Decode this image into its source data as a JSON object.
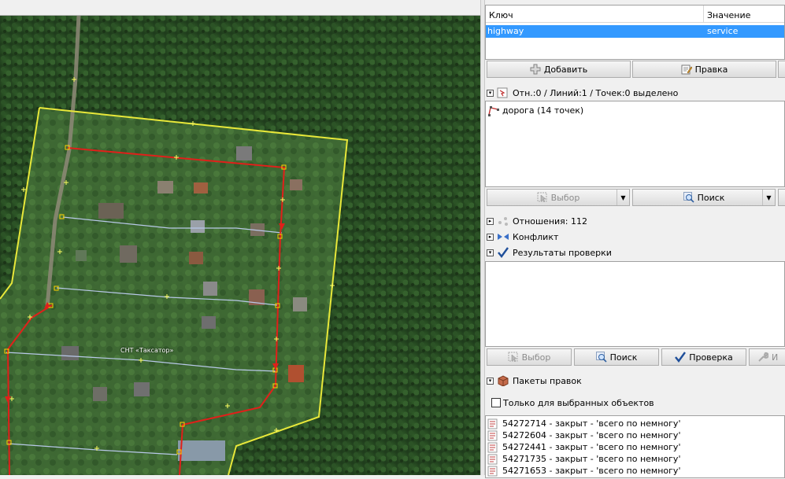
{
  "map": {
    "place_label": "СНТ «Таксатор»"
  },
  "tags": {
    "col_key": "Ключ",
    "col_value": "Значение",
    "rows": [
      {
        "key": "highway",
        "value": "service"
      }
    ],
    "add_label": "Добавить",
    "edit_label": "Правка"
  },
  "selection": {
    "header": "Отн.:0 / Линий:1 / Точек:0 выделено",
    "items": [
      {
        "label": "дорога (14 точек)"
      }
    ],
    "select_label": "Выбор",
    "search_label": "Поиск"
  },
  "relations": {
    "header": "Отношения: 112"
  },
  "conflict": {
    "header": "Конфликт"
  },
  "validation": {
    "header": "Результаты проверки",
    "select_label": "Выбор",
    "search_label": "Поиск",
    "check_label": "Проверка",
    "fix_label": "И"
  },
  "changesets": {
    "header": "Пакеты правок",
    "only_selected_label": "Только для выбранных объектов",
    "items": [
      {
        "label": "54272714 - закрыт - 'всего по немногу'"
      },
      {
        "label": "54272604 - закрыт - 'всего по немногу'"
      },
      {
        "label": "54272441 - закрыт - 'всего по немногу'"
      },
      {
        "label": "54271735 - закрыт - 'всего по немногу'"
      },
      {
        "label": "54271653 - закрыт - 'всего по немногу'"
      }
    ]
  },
  "colors": {
    "selection_row": "#3399ff",
    "area_outline": "#e8e83a",
    "selected_way": "#e0201a",
    "ways": "#b8c8e8"
  }
}
